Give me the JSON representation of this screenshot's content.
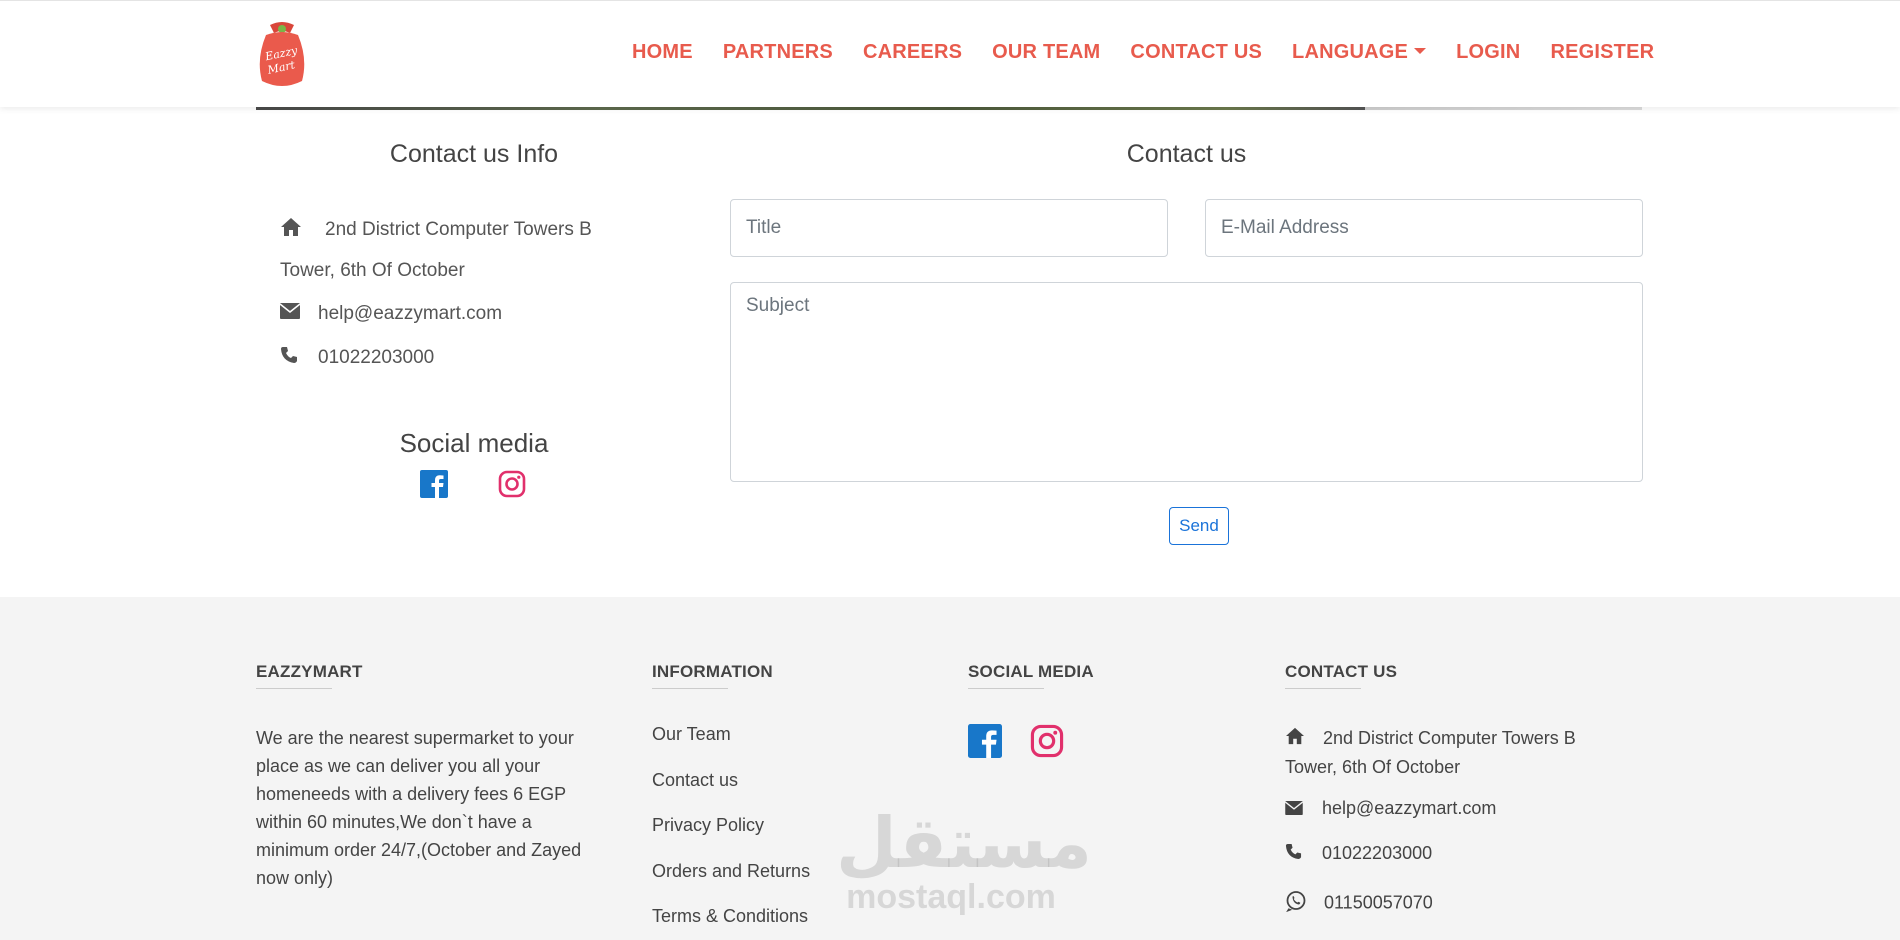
{
  "brand": {
    "name": "EAZZYMART",
    "logo_text": "Eazzy Mart",
    "accent": "#e85b4d"
  },
  "nav": {
    "items": [
      "HOME",
      "PARTNERS",
      "CAREERS",
      "OUR TEAM",
      "CONTACT US",
      "LANGUAGE",
      "LOGIN",
      "REGISTER"
    ]
  },
  "contact_info": {
    "title": "Contact us Info",
    "address_line1": "2nd District Computer Towers B",
    "address_line2": "Tower, 6th Of October",
    "email": "help@eazzymart.com",
    "phone": "01022203000"
  },
  "social": {
    "title": "Social media"
  },
  "form": {
    "title": "Contact us",
    "title_placeholder": "Title",
    "email_placeholder": "E-Mail Address",
    "subject_placeholder": "Subject",
    "send_label": "Send"
  },
  "footer": {
    "col1": {
      "heading": "EAZZYMART",
      "about": "We are the nearest supermarket to your place as we can deliver you all your homeneeds with a delivery fees 6 EGP within 60 minutes,We don`t have a minimum order 24/7,(October and Zayed now only)"
    },
    "col2": {
      "heading": "INFORMATION",
      "links": [
        "Our Team",
        "Contact us",
        "Privacy Policy",
        "Orders and Returns",
        "Terms & Conditions"
      ]
    },
    "col3": {
      "heading": "SOCIAL MEDIA"
    },
    "col4": {
      "heading": "CONTACT US",
      "address": "2nd District Computer Towers B Tower, 6th Of October",
      "email": "help@eazzymart.com",
      "phone": "01022203000",
      "whatsapp": "01150057070"
    }
  },
  "watermark": {
    "arabic": "مستقل",
    "latin": "mostaql.com"
  },
  "colors": {
    "facebook": "#1877c9",
    "instagram": "#e1306c",
    "send": "#1a73d9"
  }
}
